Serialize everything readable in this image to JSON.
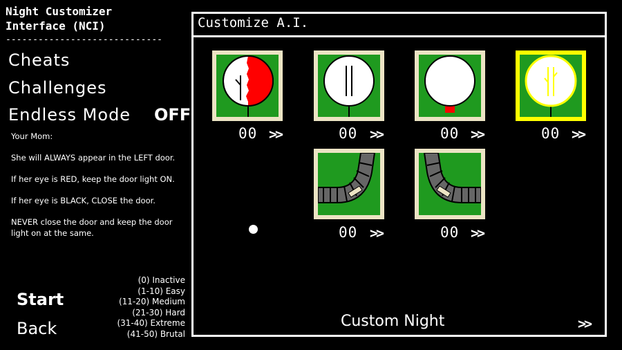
{
  "sidebar": {
    "title": "Night Customizer\nInterface (NCI)",
    "divider": "-----------------------------",
    "menu": {
      "cheats": "Cheats",
      "challenges": "Challenges",
      "endless_mode": "Endless Mode",
      "endless_state": "OFF"
    },
    "description": [
      "Your Mom:",
      "She will ALWAYS appear in the LEFT door.",
      "If her eye is RED, keep the door light ON.",
      "If her eye is BLACK, CLOSE the door.",
      "NEVER close the door and keep the door light on at the same."
    ],
    "start_label": "Start",
    "back_label": "Back",
    "difficulty_levels": [
      "(0) Inactive",
      "(1-10) Easy",
      "(11-20) Medium",
      "(21-30) Hard",
      "(31-40) Extreme",
      "(41-50) Brutal"
    ]
  },
  "panel": {
    "title": "Customize A.I.",
    "cards": [
      {
        "value": "00",
        "arrow": ">>",
        "icon": "mom-eye-red-icon",
        "selected": false
      },
      {
        "value": "00",
        "arrow": ">>",
        "icon": "double-line-face-icon",
        "selected": false
      },
      {
        "value": "00",
        "arrow": ">>",
        "icon": "blank-face-icon",
        "selected": false
      },
      {
        "value": "00",
        "arrow": ">>",
        "icon": "yellow-crack-face-icon",
        "selected": true
      },
      {
        "value": "00",
        "arrow": ">>",
        "icon": "left-vent-pipe-icon",
        "selected": false
      },
      {
        "value": "00",
        "arrow": ">>",
        "icon": "right-vent-pipe-icon",
        "selected": false
      }
    ],
    "custom_night_label": "Custom Night",
    "custom_night_arrow": ">>"
  },
  "colors": {
    "background": "#000000",
    "card_frame": "#ece4c4",
    "card_selected": "#ffff00",
    "card_green": "#1f9a1f",
    "accent_red": "#ff0000"
  }
}
